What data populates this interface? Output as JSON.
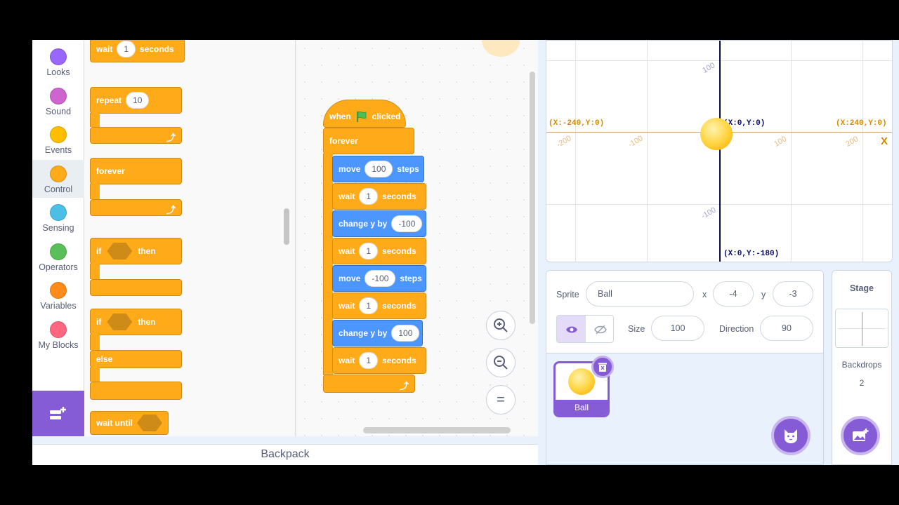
{
  "categories": [
    {
      "label": "Looks",
      "color": "#9966ff"
    },
    {
      "label": "Sound",
      "color": "#cf63cf"
    },
    {
      "label": "Events",
      "color": "#ffbf00"
    },
    {
      "label": "Control",
      "color": "#ffab19"
    },
    {
      "label": "Sensing",
      "color": "#4cbfe6"
    },
    {
      "label": "Operators",
      "color": "#59c059"
    },
    {
      "label": "Variables",
      "color": "#ff8c1a"
    },
    {
      "label": "My Blocks",
      "color": "#ff6680"
    }
  ],
  "selected_category": "Control",
  "palette": {
    "wait_label": "wait",
    "wait_value": "1",
    "wait_unit": "seconds",
    "repeat_label": "repeat",
    "repeat_value": "10",
    "forever_label": "forever",
    "if_label": "if",
    "then_label": "then",
    "if2_label": "if",
    "then2_label": "then",
    "else_label": "else",
    "wait_until_label": "wait until"
  },
  "script": {
    "hat_when": "when",
    "hat_clicked": "clicked",
    "hat_icon": "green-flag-icon",
    "forever": "forever",
    "blocks": [
      {
        "pre": "move",
        "value": "100",
        "post": "steps",
        "kind": "motion"
      },
      {
        "pre": "wait",
        "value": "1",
        "post": "seconds",
        "kind": "control"
      },
      {
        "pre": "change y by",
        "value": "-100",
        "post": "",
        "kind": "motion"
      },
      {
        "pre": "wait",
        "value": "1",
        "post": "seconds",
        "kind": "control"
      },
      {
        "pre": "move",
        "value": "-100",
        "post": "steps",
        "kind": "motion"
      },
      {
        "pre": "wait",
        "value": "1",
        "post": "seconds",
        "kind": "control"
      },
      {
        "pre": "change y by",
        "value": "100",
        "post": "",
        "kind": "motion"
      },
      {
        "pre": "wait",
        "value": "1",
        "post": "seconds",
        "kind": "control"
      }
    ]
  },
  "zoom": {
    "in": "+",
    "out": "−",
    "reset": "="
  },
  "backpack": "Backpack",
  "stage": {
    "left_coord": "(X:-240,Y:0)",
    "center_coord": "(X:0,Y:0)",
    "right_coord": "(X:240,Y:0)",
    "bottom_coord": "(X:0,Y:-180)",
    "x_axis_label": "X",
    "x_ticks": [
      "-200",
      "-100",
      "100",
      "200"
    ],
    "y_ticks": [
      "100",
      "-100"
    ]
  },
  "sprite_info": {
    "sprite_label": "Sprite",
    "sprite_name": "Ball",
    "x_label": "x",
    "x_value": "-4",
    "y_label": "y",
    "y_value": "-3",
    "show_label": "Show",
    "size_label": "Size",
    "size_value": "100",
    "direction_label": "Direction",
    "direction_value": "90"
  },
  "sprites": [
    {
      "name": "Ball"
    }
  ],
  "stage_panel": {
    "title": "Stage",
    "backdrops_label": "Backdrops",
    "backdrops_count": "2"
  }
}
